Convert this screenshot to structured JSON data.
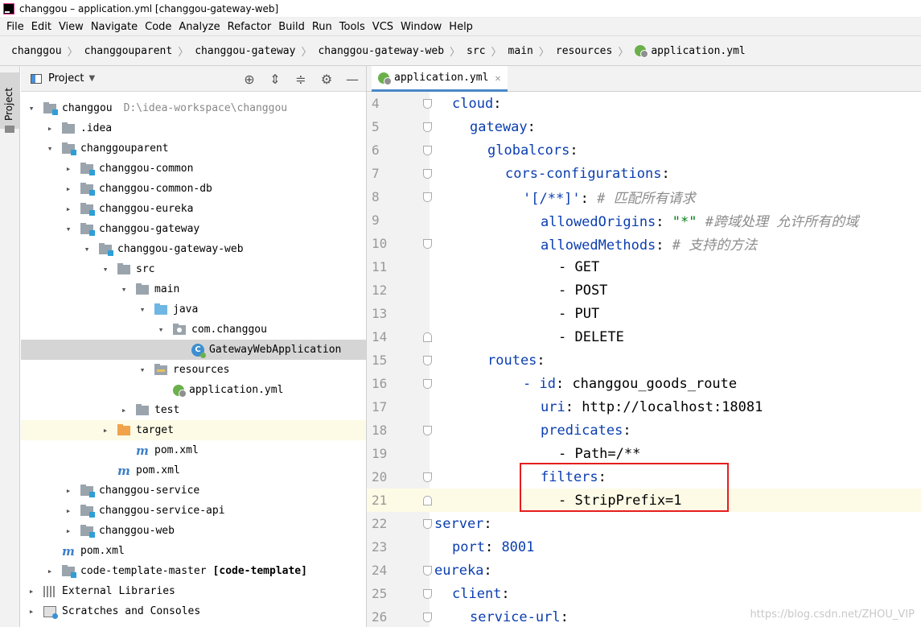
{
  "window": {
    "title": "changgou – application.yml [changgou-gateway-web]"
  },
  "menu": [
    "File",
    "Edit",
    "View",
    "Navigate",
    "Code",
    "Analyze",
    "Refactor",
    "Build",
    "Run",
    "Tools",
    "VCS",
    "Window",
    "Help"
  ],
  "breadcrumb": [
    "changgou",
    "changgouparent",
    "changgou-gateway",
    "changgou-gateway-web",
    "src",
    "main",
    "resources",
    "application.yml"
  ],
  "toolstrip": {
    "project_tab": "Project"
  },
  "project_panel": {
    "title": "Project",
    "tree": [
      {
        "label": "changgou",
        "path": "D:\\idea-workspace\\changgou",
        "arrow": "▾",
        "icon": "module-folder"
      },
      {
        "label": ".idea",
        "arrow": "▸",
        "icon": "folder"
      },
      {
        "label": "changgouparent",
        "arrow": "▾",
        "icon": "module-folder"
      },
      {
        "label": "changgou-common",
        "arrow": "▸",
        "icon": "module-folder"
      },
      {
        "label": "changgou-common-db",
        "arrow": "▸",
        "icon": "module-folder"
      },
      {
        "label": "changgou-eureka",
        "arrow": "▸",
        "icon": "module-folder"
      },
      {
        "label": "changgou-gateway",
        "arrow": "▾",
        "icon": "module-folder"
      },
      {
        "label": "changgou-gateway-web",
        "arrow": "▾",
        "icon": "module-folder"
      },
      {
        "label": "src",
        "arrow": "▾",
        "icon": "folder"
      },
      {
        "label": "main",
        "arrow": "▾",
        "icon": "folder"
      },
      {
        "label": "java",
        "arrow": "▾",
        "icon": "source-folder"
      },
      {
        "label": "com.changgou",
        "arrow": "▾",
        "icon": "package"
      },
      {
        "label": "GatewayWebApplication",
        "arrow": "",
        "icon": "spring-class"
      },
      {
        "label": "resources",
        "arrow": "▾",
        "icon": "resources-folder"
      },
      {
        "label": "application.yml",
        "arrow": "",
        "icon": "yml-file"
      },
      {
        "label": "test",
        "arrow": "▸",
        "icon": "folder"
      },
      {
        "label": "target",
        "arrow": "▸",
        "icon": "excluded-folder"
      },
      {
        "label": "pom.xml",
        "arrow": "",
        "icon": "maven-file"
      },
      {
        "label": "pom.xml",
        "arrow": "",
        "icon": "maven-file"
      },
      {
        "label": "changgou-service",
        "arrow": "▸",
        "icon": "module-folder"
      },
      {
        "label": "changgou-service-api",
        "arrow": "▸",
        "icon": "module-folder"
      },
      {
        "label": "changgou-web",
        "arrow": "▸",
        "icon": "module-folder"
      },
      {
        "label": "pom.xml",
        "arrow": "",
        "icon": "maven-file"
      },
      {
        "label": "code-template-master",
        "suffix": "[code-template]",
        "arrow": "▸",
        "icon": "module-folder"
      },
      {
        "label": "External Libraries",
        "arrow": "▸",
        "icon": "libraries"
      },
      {
        "label": "Scratches and Consoles",
        "arrow": "▸",
        "icon": "scratches"
      }
    ]
  },
  "editor": {
    "tab_label": "application.yml",
    "lines": [
      {
        "num": "4",
        "key": "cloud",
        "sep": ":",
        "val": "",
        "comment": ""
      },
      {
        "num": "5",
        "key": "gateway",
        "sep": ":",
        "val": "",
        "comment": ""
      },
      {
        "num": "6",
        "key": "globalcors",
        "sep": ":",
        "val": "",
        "comment": ""
      },
      {
        "num": "7",
        "key": "cors-configurations",
        "sep": ":",
        "val": "",
        "comment": ""
      },
      {
        "num": "8",
        "key": "'[/**]'",
        "sep": ":",
        "val": "",
        "comment": " # 匹配所有请求"
      },
      {
        "num": "9",
        "key": "allowedOrigins",
        "sep": ": ",
        "val": "\"*\"",
        "comment": " #跨域处理 允许所有的域"
      },
      {
        "num": "10",
        "key": "allowedMethods",
        "sep": ":",
        "val": "",
        "comment": " # 支持的方法"
      },
      {
        "num": "11",
        "key": "",
        "sep": "",
        "val": "- GET",
        "comment": ""
      },
      {
        "num": "12",
        "key": "",
        "sep": "",
        "val": "- POST",
        "comment": ""
      },
      {
        "num": "13",
        "key": "",
        "sep": "",
        "val": "- PUT",
        "comment": ""
      },
      {
        "num": "14",
        "key": "",
        "sep": "",
        "val": "- DELETE",
        "comment": ""
      },
      {
        "num": "15",
        "key": "routes",
        "sep": ":",
        "val": "",
        "comment": ""
      },
      {
        "num": "16",
        "key": "- id",
        "sep": ": ",
        "val": "changgou_goods_route",
        "comment": ""
      },
      {
        "num": "17",
        "key": "uri",
        "sep": ": ",
        "val": "http://localhost:18081",
        "comment": ""
      },
      {
        "num": "18",
        "key": "predicates",
        "sep": ":",
        "val": "",
        "comment": ""
      },
      {
        "num": "19",
        "key": "",
        "sep": "",
        "val": "- Path=/**",
        "comment": ""
      },
      {
        "num": "20",
        "key": "filters",
        "sep": ":",
        "val": "",
        "comment": ""
      },
      {
        "num": "21",
        "key": "",
        "sep": "",
        "val": "- StripPrefix=1",
        "comment": ""
      },
      {
        "num": "22",
        "key": "server",
        "sep": ":",
        "val": "",
        "comment": ""
      },
      {
        "num": "23",
        "key": "port",
        "sep": ": ",
        "val": "8001",
        "comment": ""
      },
      {
        "num": "24",
        "key": "eureka",
        "sep": ":",
        "val": "",
        "comment": ""
      },
      {
        "num": "25",
        "key": "client",
        "sep": ":",
        "val": "",
        "comment": ""
      },
      {
        "num": "26",
        "key": "service-url",
        "sep": ":",
        "val": "",
        "comment": ""
      }
    ]
  },
  "watermark": "https://blog.csdn.net/ZHOU_VIP"
}
